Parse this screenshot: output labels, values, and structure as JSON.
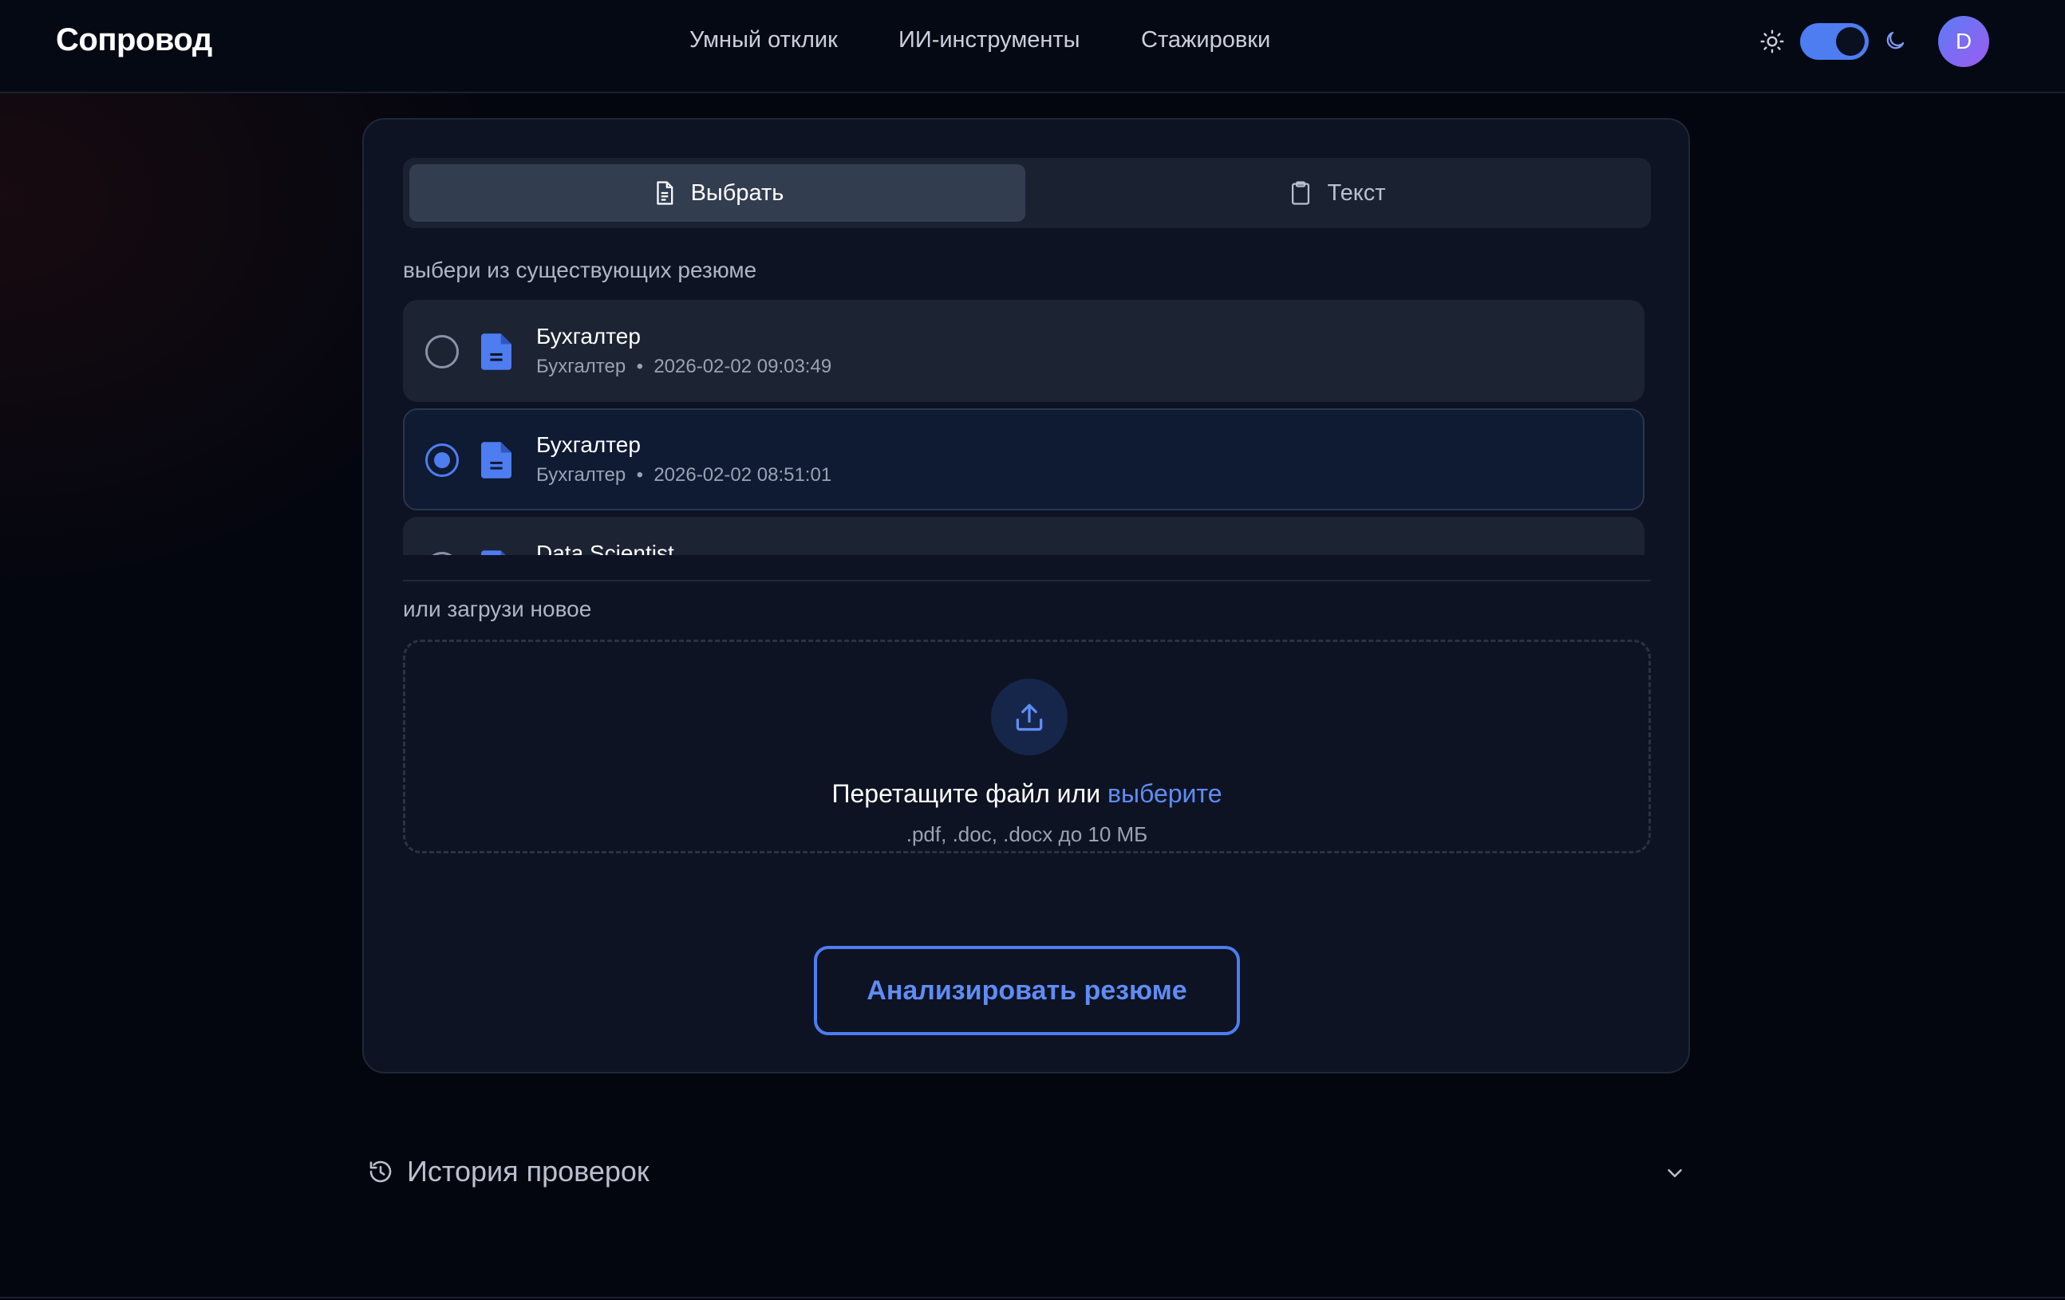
{
  "header": {
    "logo": "Сопровод",
    "nav": [
      "Умный отклик",
      "ИИ-инструменты",
      "Стажировки"
    ],
    "avatar_letter": "D",
    "theme_toggle_on": true
  },
  "tabs": [
    {
      "label": "Выбрать",
      "icon": "file-icon",
      "active": true
    },
    {
      "label": "Текст",
      "icon": "clipboard-icon",
      "active": false
    }
  ],
  "existing_label": "выбери из существующих резюме",
  "resumes": [
    {
      "title": "Бухгалтер",
      "subtitle": "Бухгалтер",
      "date": "2026-02-02 09:03:49",
      "selected": false
    },
    {
      "title": "Бухгалтер",
      "subtitle": "Бухгалтер",
      "date": "2026-02-02 08:51:01",
      "selected": true
    },
    {
      "title": "Data Scientist",
      "subtitle": "",
      "date": "",
      "selected": false
    }
  ],
  "meta_separator": "•",
  "upload": {
    "label": "или загрузи новое",
    "text": "Перетащите файл или ",
    "link": "выберите",
    "hint": ".pdf, .doc, .docx до 10 МБ"
  },
  "analyze_button": "Анализировать резюме",
  "history": {
    "title": "История проверок"
  },
  "colors": {
    "accent": "#4d7df0",
    "background": "#04060f",
    "card": "#0d1322"
  }
}
